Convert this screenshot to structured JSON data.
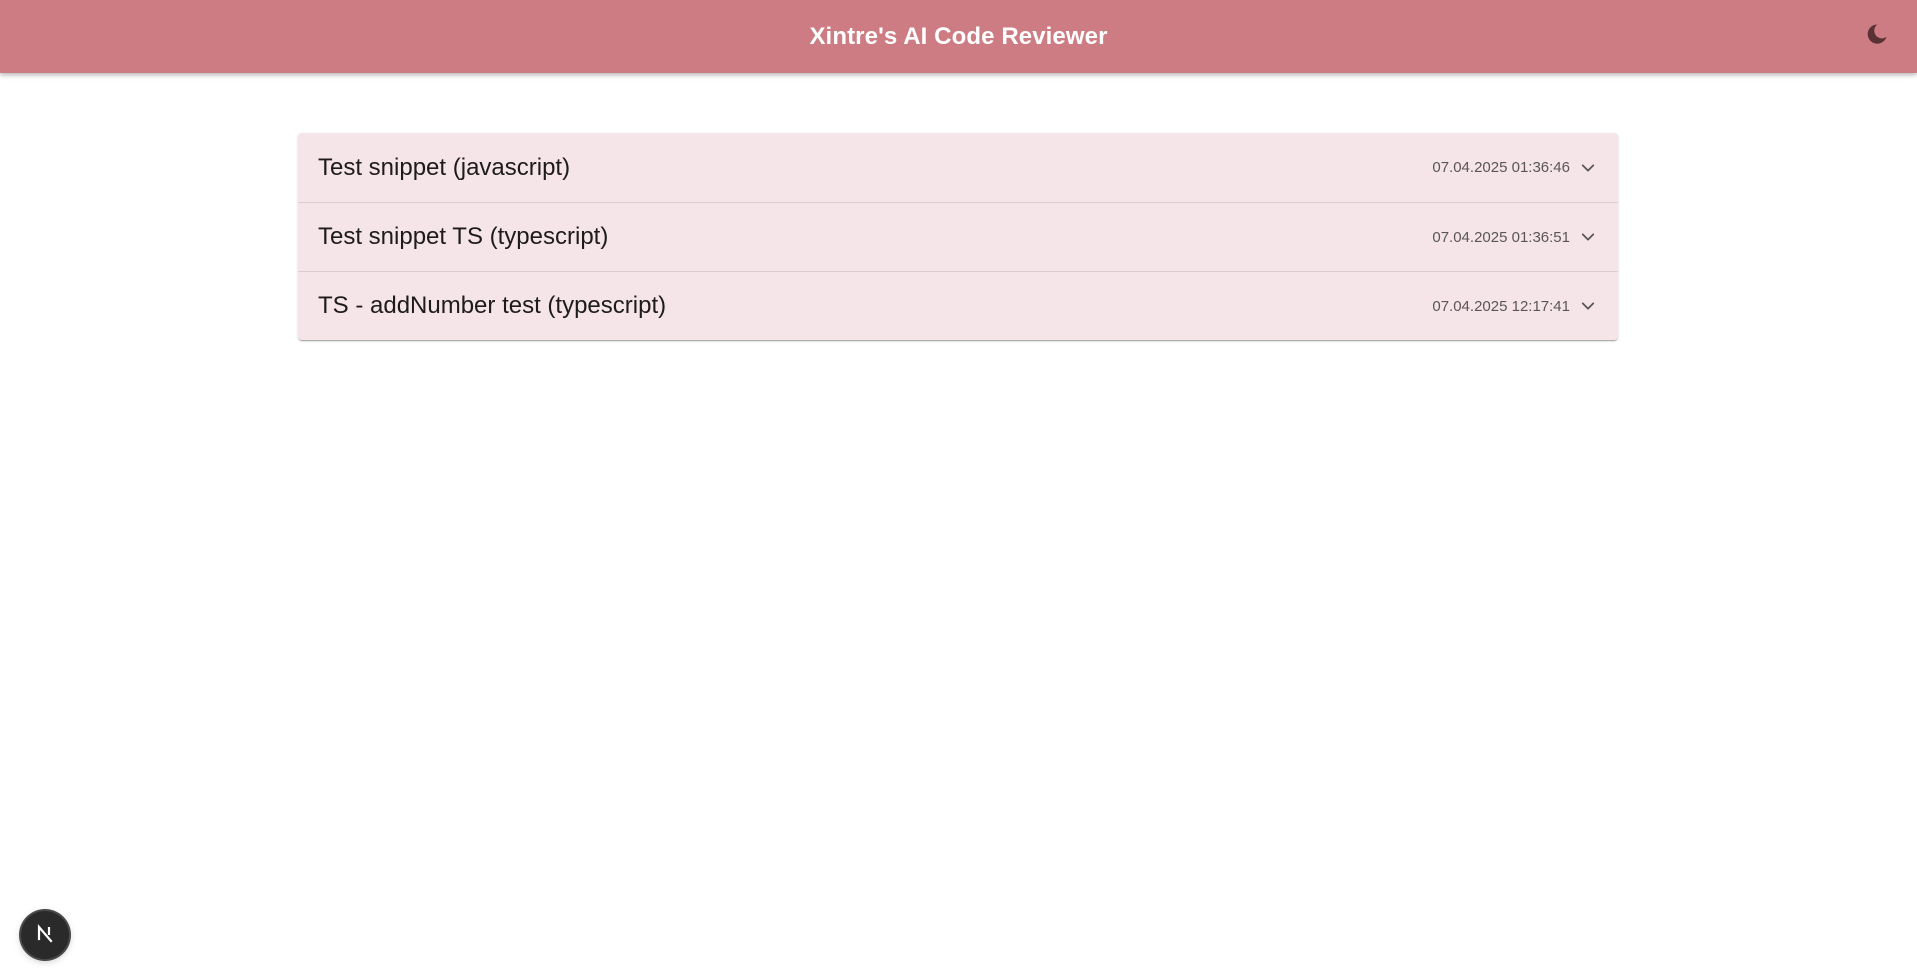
{
  "app": {
    "title": "Xintre's AI Code Reviewer",
    "theme_toggle_icon": "moon-icon",
    "accent_color": "#cc7c82",
    "row_background": "#f6e5e8"
  },
  "snippets": [
    {
      "title": "Test snippet (javascript)",
      "date": "07.04.2025 01:36:46",
      "expand_icon": "chevron-down-icon"
    },
    {
      "title": "Test snippet TS (typescript)",
      "date": "07.04.2025 01:36:51",
      "expand_icon": "chevron-down-icon"
    },
    {
      "title": "TS - addNumber test (typescript)",
      "date": "07.04.2025 12:17:41",
      "expand_icon": "chevron-down-icon"
    }
  ],
  "dev_badge": {
    "icon": "nextjs-logo-icon"
  }
}
